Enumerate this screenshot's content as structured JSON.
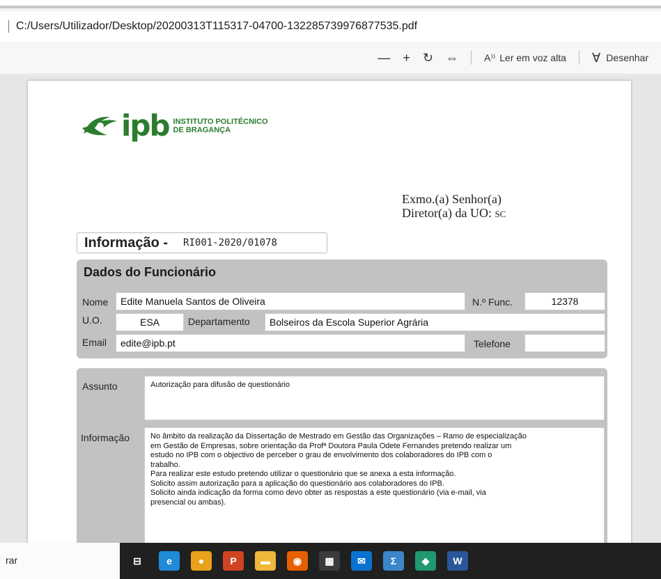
{
  "window": {
    "address": "C:/Users/Utilizador/Desktop/20200313T115317-04700-132285739976877535.pdf"
  },
  "toolbar": {
    "zoom_out_glyph": "—",
    "zoom_in_glyph": "+",
    "rotate_glyph": "↻",
    "fit_glyph": "⇔",
    "read_aloud_glyph": "A⁾⁾",
    "read_aloud_label": "Ler em voz alta",
    "draw_glyph": "∀",
    "draw_label": "Desenhar"
  },
  "document": {
    "logo": {
      "text": "ipb",
      "line1": "INSTITUTO POLITÉCNICO",
      "line2": "DE BRAGANÇA"
    },
    "recipient": {
      "line1": "Exmo.(a) Senhor(a)",
      "line2": "Diretor(a) da UO:",
      "uo": "SC"
    },
    "info": {
      "label": "Informação -",
      "number": "RI001-2020/01078"
    },
    "employee": {
      "title": "Dados do Funcionário",
      "name_label": "Nome",
      "name": "Edite Manuela Santos de Oliveira",
      "func_label": "N.º Func.",
      "func": "12378",
      "uo_label": "U.O.",
      "uo": "ESA",
      "dept_label": "Departamento",
      "dept": "Bolseiros da Escola Superior Agrária",
      "email_label": "Email",
      "email": "edite@ipb.pt",
      "phone_label": "Telefone",
      "phone": ""
    },
    "request": {
      "subject_label": "Assunto",
      "subject": "Autorização para difusão de questionário",
      "info_label": "Informação",
      "info_lines": [
        "No âmbito da realização da Dissertação de Mestrado em Gestão das Organizações – Ramo de especialização",
        "em Gestão de Empresas, sobre orientação da Profª Doutora Paula Odete Fernandes pretendo realizar um",
        "estudo no IPB com o objectivo de perceber o grau de envolvimento dos colaboradores do IPB com o",
        "trabalho.",
        "Para realizar este estudo pretendo utilizar o questionário que se anexa a esta informação.",
        "Solicito assim autorização para a aplicação do questionário aos colaboradores do IPB.",
        "Solicito ainda indicação da forma como devo obter as respostas a este questionário (via e-mail, via",
        "presencial ou ambas)."
      ]
    }
  },
  "status": {
    "text": "rar"
  },
  "taskbar": {
    "items": [
      {
        "name": "task-view-icon",
        "glyph": "⊟",
        "color": "#202020"
      },
      {
        "name": "edge-icon",
        "glyph": "e",
        "color": "#1f8ad8"
      },
      {
        "name": "chrome-icon",
        "glyph": "●",
        "color": "#e9a21b"
      },
      {
        "name": "powerpoint-icon",
        "glyph": "P",
        "color": "#d04423"
      },
      {
        "name": "file-explorer-icon",
        "glyph": "▬",
        "color": "#f0b83a"
      },
      {
        "name": "firefox-icon",
        "glyph": "◉",
        "color": "#e66000"
      },
      {
        "name": "store-icon",
        "glyph": "▦",
        "color": "#3b3b3b"
      },
      {
        "name": "mail-icon",
        "glyph": "✉",
        "color": "#0a73d0"
      },
      {
        "name": "calculator-icon",
        "glyph": "Σ",
        "color": "#3a86c8"
      },
      {
        "name": "security-icon",
        "glyph": "◆",
        "color": "#1f9a6e"
      },
      {
        "name": "word-icon",
        "glyph": "W",
        "color": "#2b579a"
      }
    ]
  }
}
